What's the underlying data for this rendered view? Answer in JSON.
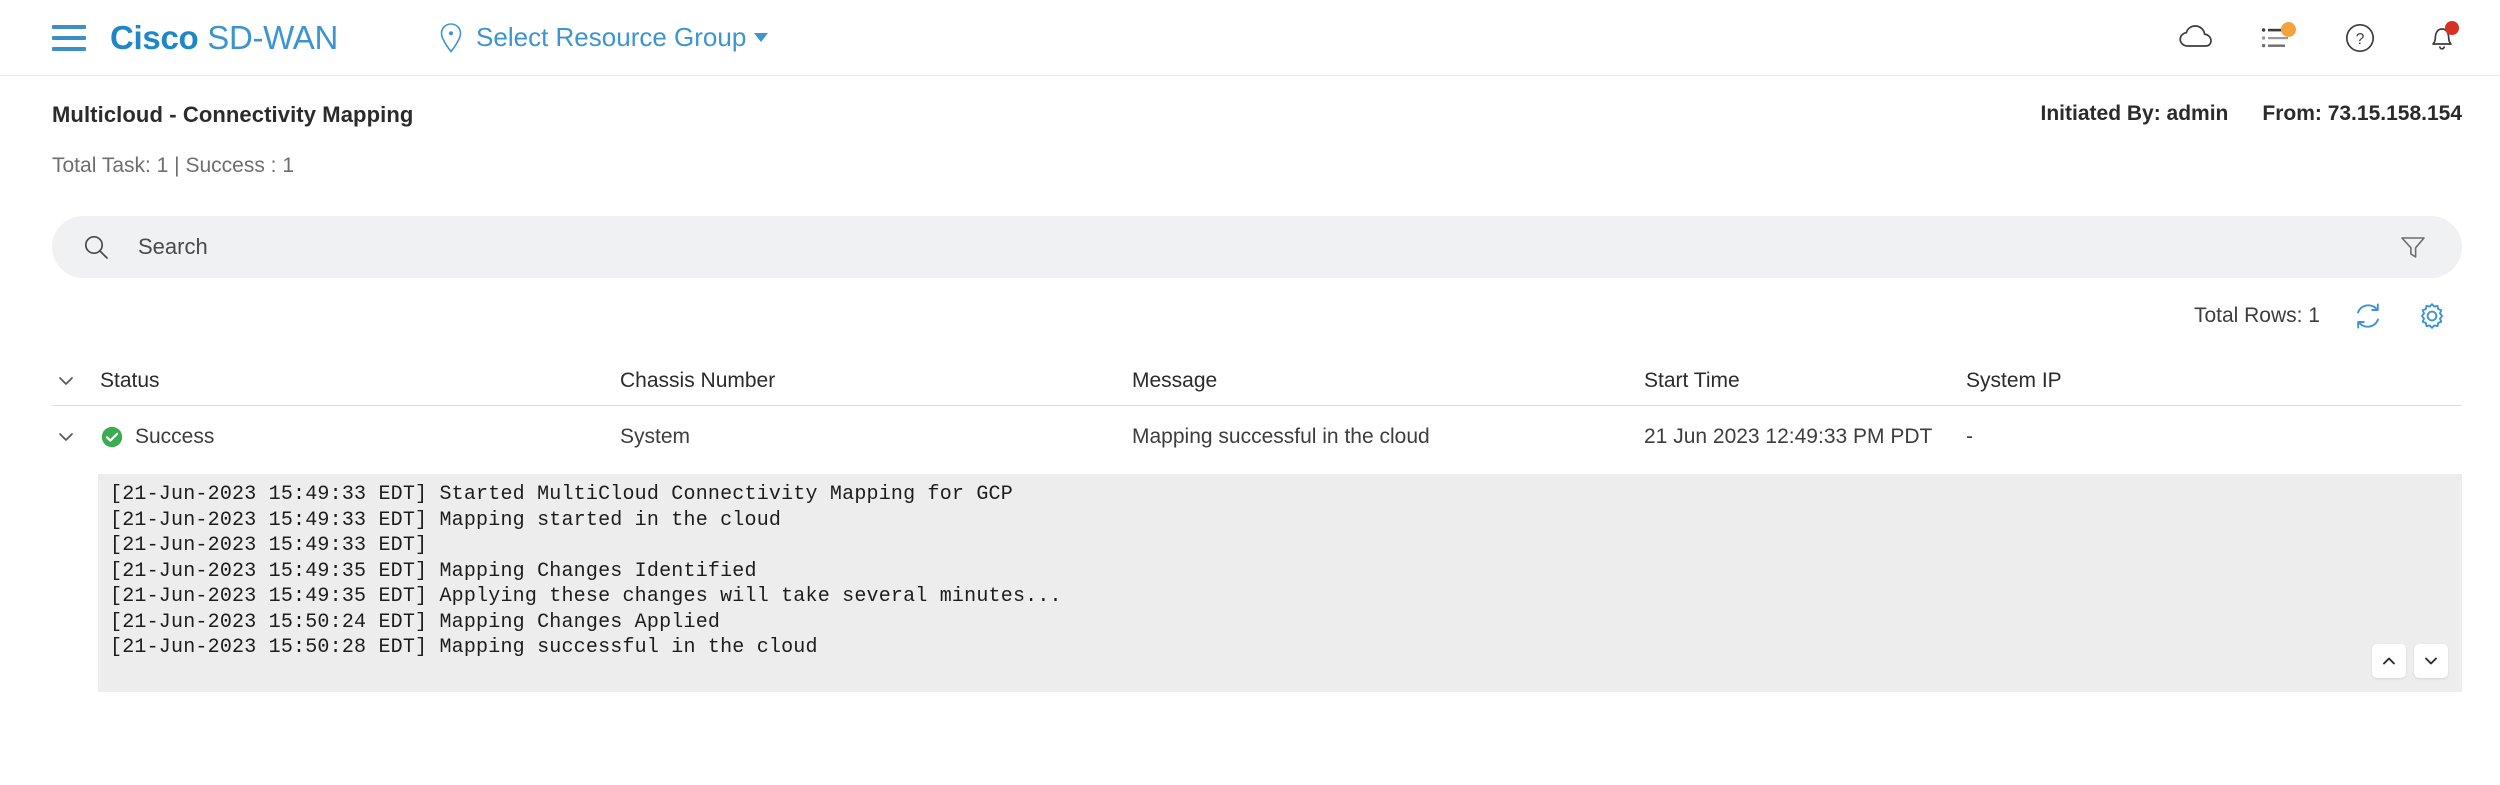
{
  "header": {
    "menu_icon": "hamburger-menu-icon",
    "brand_primary": "Cisco",
    "brand_secondary": "SD-WAN",
    "resource_group_label": "Select Resource Group",
    "icons": [
      {
        "name": "cloud-icon",
        "badge": null
      },
      {
        "name": "tasks-icon",
        "badge": "#f2a33c"
      },
      {
        "name": "help-icon",
        "badge": null
      },
      {
        "name": "notifications-bell-icon",
        "badge": "#d93025"
      }
    ]
  },
  "page": {
    "title": "Multicloud - Connectivity Mapping",
    "initiated_by": "Initiated By: admin",
    "from": "From: 73.15.158.154",
    "task_summary": "Total Task: 1 | Success : 1"
  },
  "search": {
    "placeholder": "Search",
    "value": "",
    "icon": "search-icon",
    "filter_icon": "filter-funnel-icon"
  },
  "toolbar": {
    "total_rows": "Total Rows: 1",
    "refresh_icon": "refresh-icon",
    "settings_icon": "gear-icon"
  },
  "table": {
    "columns": [
      "Status",
      "Chassis Number",
      "Message",
      "Start Time",
      "System IP"
    ],
    "rows": [
      {
        "status": "Success",
        "status_color": "#3dab53",
        "chassis_number": "System",
        "message": "Mapping successful in the cloud",
        "start_time": "21 Jun 2023 12:49:33 PM PDT",
        "system_ip": "-"
      }
    ]
  },
  "log_console": {
    "lines": [
      "[21-Jun-2023 15:49:33 EDT] Started MultiCloud Connectivity Mapping for GCP",
      "[21-Jun-2023 15:49:33 EDT] Mapping started in the cloud",
      "[21-Jun-2023 15:49:33 EDT]",
      "[21-Jun-2023 15:49:35 EDT] Mapping Changes Identified",
      "[21-Jun-2023 15:49:35 EDT] Applying these changes will take several minutes...",
      "[21-Jun-2023 15:50:24 EDT] Mapping Changes Applied",
      "[21-Jun-2023 15:50:28 EDT] Mapping successful in the cloud"
    ],
    "scroll_up_icon": "chevron-up-icon",
    "scroll_down_icon": "chevron-down-icon"
  },
  "colors": {
    "brand_blue": "#1e87c8",
    "link_blue": "#3c95cf",
    "success_green": "#3dab53",
    "badge_orange": "#f2a33c",
    "badge_red": "#d93025"
  }
}
